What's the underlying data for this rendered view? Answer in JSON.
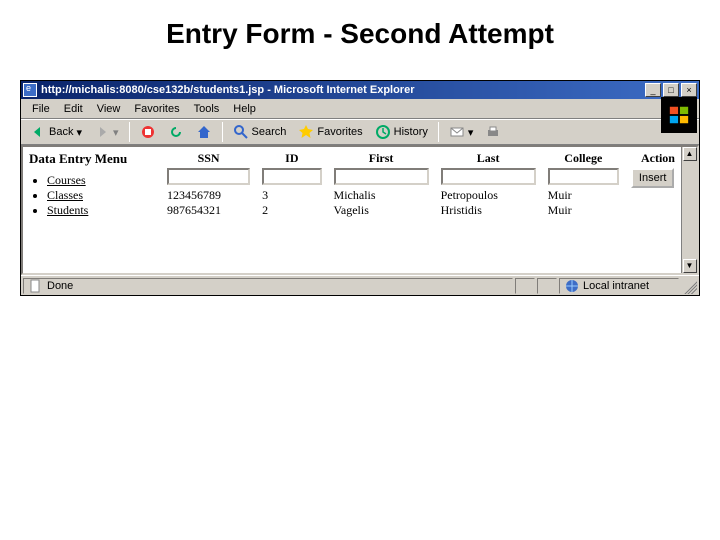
{
  "slide": {
    "title": "Entry Form - Second Attempt"
  },
  "window": {
    "title": "http://michalis:8080/cse132b/students1.jsp - Microsoft Internet Explorer",
    "buttons": {
      "min": "_",
      "max": "□",
      "close": "×"
    }
  },
  "menu": {
    "file": "File",
    "edit": "Edit",
    "view": "View",
    "favorites": "Favorites",
    "tools": "Tools",
    "help": "Help"
  },
  "toolbar": {
    "back": "Back",
    "forward": "",
    "stop": "",
    "refresh": "",
    "home": "",
    "search": "Search",
    "favorites": "Favorites",
    "history": "History"
  },
  "page": {
    "sidebar": {
      "title": "Data Entry Menu",
      "items": [
        {
          "label": "Courses"
        },
        {
          "label": "Classes"
        },
        {
          "label": "Students"
        }
      ]
    },
    "table": {
      "headers": {
        "ssn": "SSN",
        "id": "ID",
        "first": "First",
        "last": "Last",
        "college": "College",
        "action": "Action"
      },
      "inputRow": {
        "ssn": "",
        "id": "",
        "first": "",
        "last": "",
        "college": "",
        "action": "Insert"
      },
      "rows": [
        {
          "ssn": "123456789",
          "id": "3",
          "first": "Michalis",
          "last": "Petropoulos",
          "college": "Muir"
        },
        {
          "ssn": "987654321",
          "id": "2",
          "first": "Vagelis",
          "last": "Hristidis",
          "college": "Muir"
        }
      ]
    }
  },
  "status": {
    "text": "Done",
    "zone": "Local intranet"
  },
  "scroll": {
    "up": "▲",
    "down": "▼"
  }
}
